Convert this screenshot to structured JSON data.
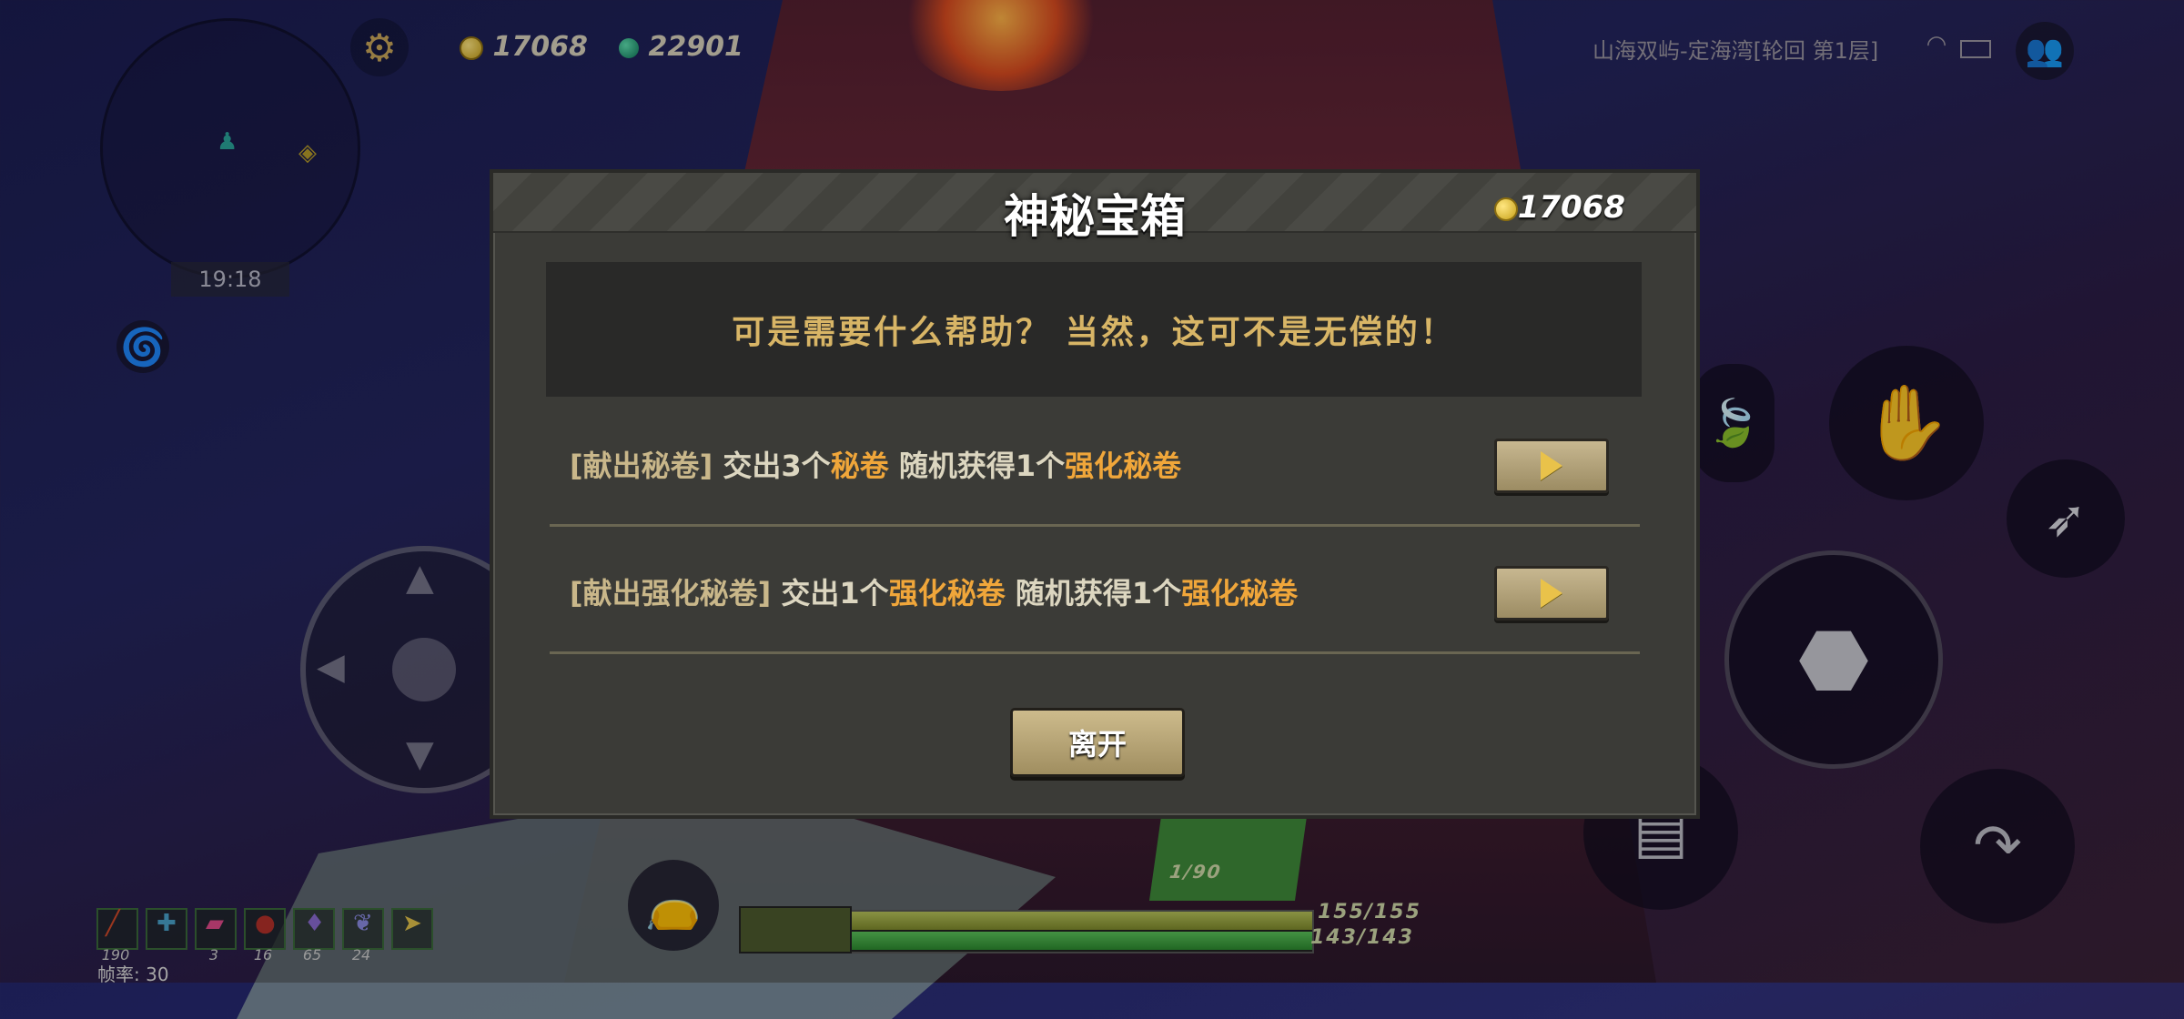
{
  "hud": {
    "gold": "17068",
    "gems": "22901",
    "location": "山海双屿-定海湾[轮回 第1层]",
    "time": "19:18",
    "fps": "帧率: 30",
    "hp": "155/155",
    "energy": "143/143",
    "ammo": "1/90",
    "items": [
      {
        "icon": "firecracker-icon",
        "count": "190"
      },
      {
        "icon": "medkit-icon",
        "count": ""
      },
      {
        "icon": "scroll-icon",
        "count": "3"
      },
      {
        "icon": "meat-icon",
        "count": "16"
      },
      {
        "icon": "potion-icon",
        "count": "65"
      },
      {
        "icon": "feather-icon",
        "count": "24"
      },
      {
        "icon": "expand-icon",
        "count": ""
      }
    ]
  },
  "dialog": {
    "title": "神秘宝箱",
    "gold": "17068",
    "prompt": "可是需要什么帮助？ 当然，这可不是无偿的！",
    "options": [
      {
        "tag": "[献出秘卷]",
        "part1": " 交出3个",
        "hl1": "秘卷",
        "part2": "  随机获得1个",
        "hl2": "强化秘卷"
      },
      {
        "tag": "[献出强化秘卷]",
        "part1": " 交出1个",
        "hl1": "强化秘卷",
        "part2": "  随机获得1个",
        "hl2": "强化秘卷"
      }
    ],
    "leave_label": "离开"
  },
  "colors": {
    "accent": "#f0a63a",
    "prompt": "#d8b566",
    "button": "#b8a77d"
  }
}
